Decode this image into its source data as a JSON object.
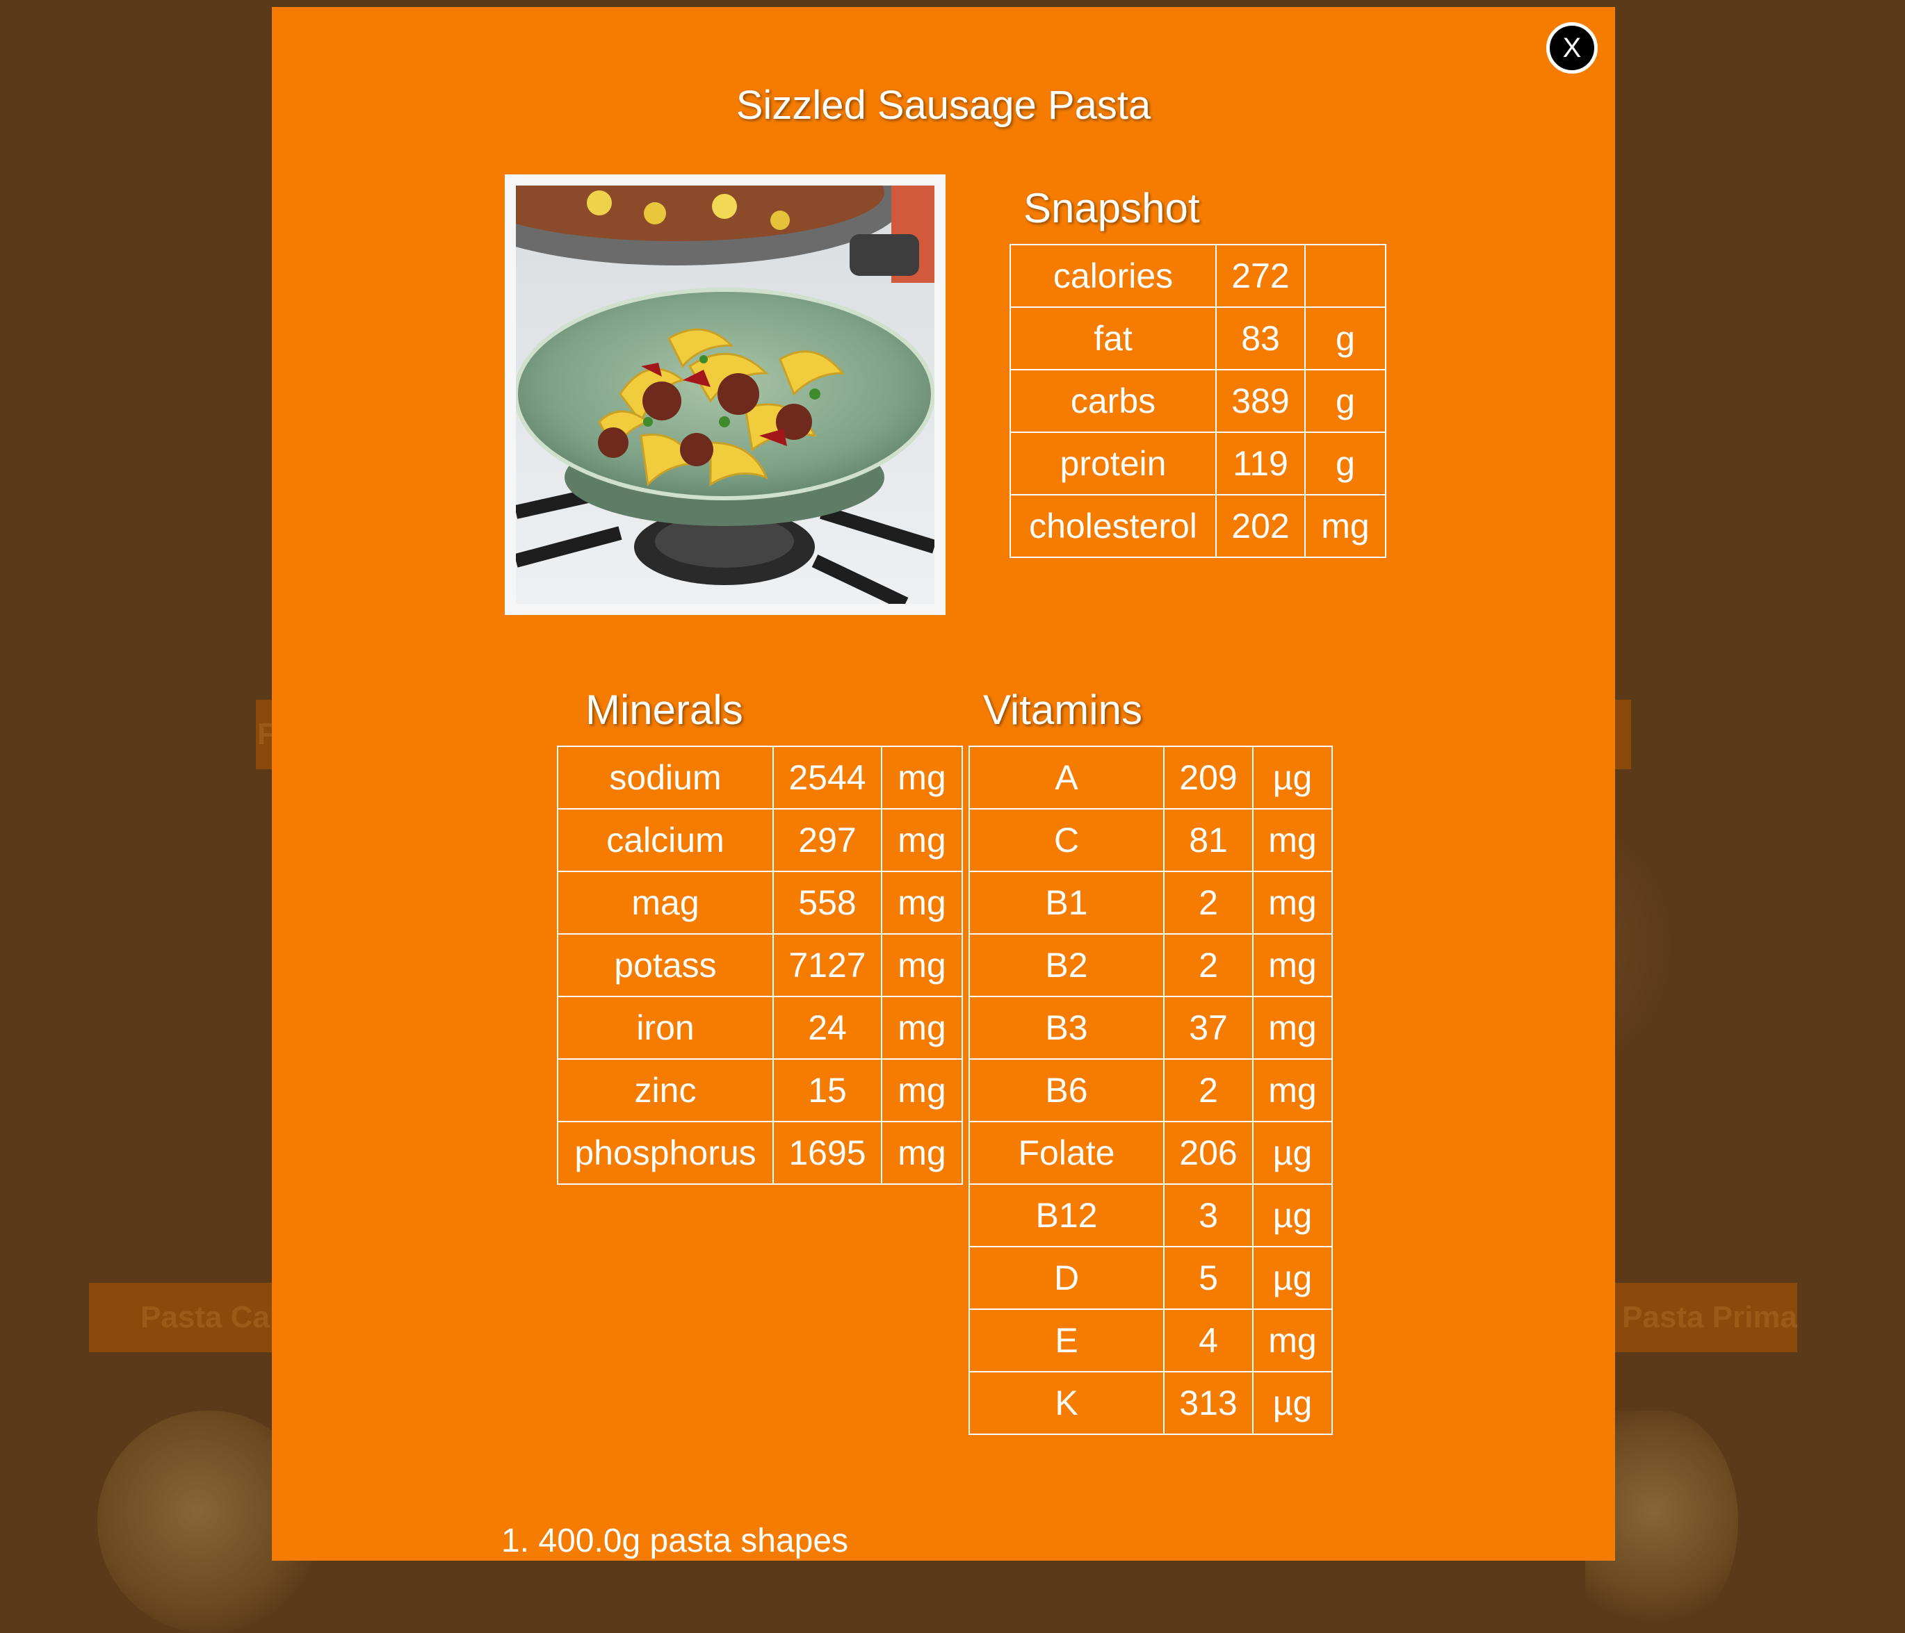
{
  "background": {
    "card_left_partial": "Pasta Carbo",
    "card_right_partial": "Pasta Primavera",
    "card_mid_partial": "F"
  },
  "modal": {
    "close_label": "X",
    "title": "Sizzled Sausage Pasta",
    "image_alt": "sausage pasta dish",
    "snapshot": {
      "heading": "Snapshot",
      "rows": [
        {
          "name": "calories",
          "value": "272",
          "unit": ""
        },
        {
          "name": "fat",
          "value": "83",
          "unit": "g"
        },
        {
          "name": "carbs",
          "value": "389",
          "unit": "g"
        },
        {
          "name": "protein",
          "value": "119",
          "unit": "g"
        },
        {
          "name": "cholesterol",
          "value": "202",
          "unit": "mg"
        }
      ]
    },
    "minerals": {
      "heading": "Minerals",
      "rows": [
        {
          "name": "sodium",
          "value": "2544",
          "unit": "mg"
        },
        {
          "name": "calcium",
          "value": "297",
          "unit": "mg"
        },
        {
          "name": "mag",
          "value": "558",
          "unit": "mg"
        },
        {
          "name": "potass",
          "value": "7127",
          "unit": "mg"
        },
        {
          "name": "iron",
          "value": "24",
          "unit": "mg"
        },
        {
          "name": "zinc",
          "value": "15",
          "unit": "mg"
        },
        {
          "name": "phosphorus",
          "value": "1695",
          "unit": "mg"
        }
      ]
    },
    "vitamins": {
      "heading": "Vitamins",
      "rows": [
        {
          "name": "A",
          "value": "209",
          "unit": "µg"
        },
        {
          "name": "C",
          "value": "81",
          "unit": "mg"
        },
        {
          "name": "B1",
          "value": "2",
          "unit": "mg"
        },
        {
          "name": "B2",
          "value": "2",
          "unit": "mg"
        },
        {
          "name": "B3",
          "value": "37",
          "unit": "mg"
        },
        {
          "name": "B6",
          "value": "2",
          "unit": "mg"
        },
        {
          "name": "Folate",
          "value": "206",
          "unit": "µg"
        },
        {
          "name": "B12",
          "value": "3",
          "unit": "µg"
        },
        {
          "name": "D",
          "value": "5",
          "unit": "µg"
        },
        {
          "name": "E",
          "value": "4",
          "unit": "mg"
        },
        {
          "name": "K",
          "value": "313",
          "unit": "µg"
        }
      ]
    },
    "ingredients": [
      "1. 400.0g pasta shapes"
    ]
  },
  "colors": {
    "modal_bg": "#f57c00",
    "page_bg": "#5b3a1a",
    "text": "#ffffff"
  }
}
